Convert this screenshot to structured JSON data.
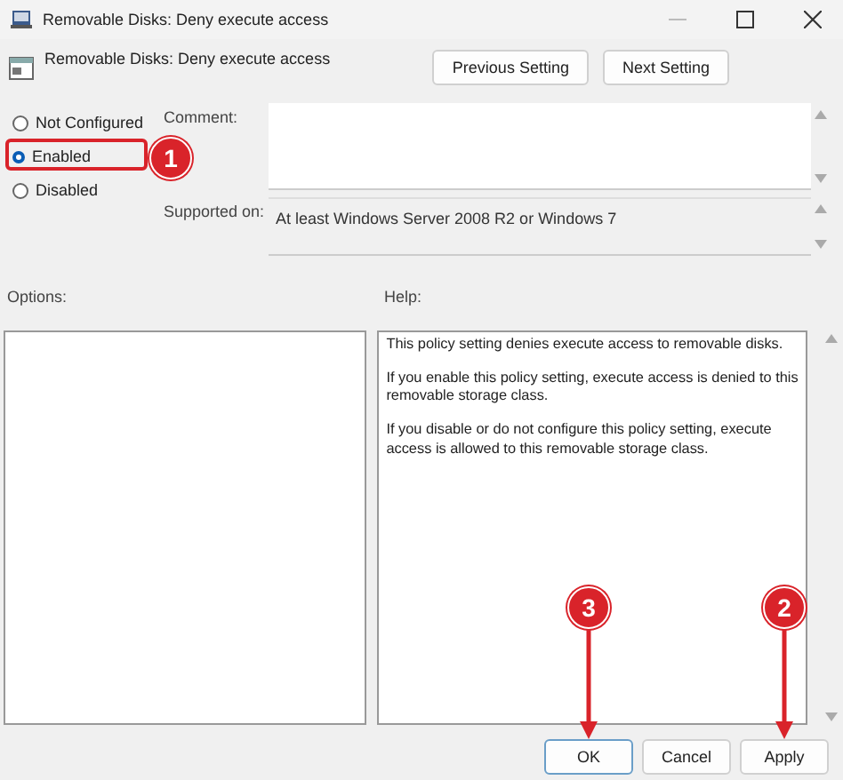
{
  "window": {
    "title": "Removable Disks: Deny execute access"
  },
  "header": {
    "title": "Removable Disks: Deny execute access",
    "buttons": [
      "Previous Setting",
      "Next Setting"
    ]
  },
  "state_options": [
    {
      "label": "Not Configured",
      "selected": false
    },
    {
      "label": "Enabled",
      "selected": true,
      "callout": "1"
    },
    {
      "label": "Disabled",
      "selected": false
    }
  ],
  "comment": {
    "label": "Comment:"
  },
  "supported_on": {
    "label": "Supported on:",
    "value": "At least Windows Server 2008 R2 or Windows 7"
  },
  "options": {
    "label": "Options:"
  },
  "help": {
    "label": "Help:",
    "paragraphs": [
      "This policy setting denies execute access to removable disks.",
      "If you enable this policy setting, execute access is denied to this removable storage class.",
      "If you disable or do not configure this policy setting, execute access is allowed to this removable storage class."
    ]
  },
  "buttons": [
    {
      "label": "OK",
      "default": true,
      "callout": "3"
    },
    {
      "label": "Cancel",
      "default": false
    },
    {
      "label": "Apply",
      "default": false,
      "callout": "2"
    }
  ]
}
